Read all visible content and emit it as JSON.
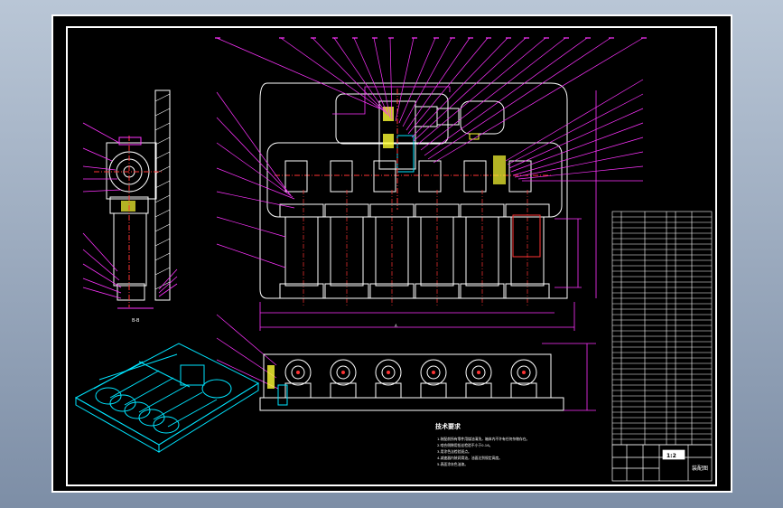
{
  "drawing": {
    "colors": {
      "background": "#000000",
      "frame": "#ffffff",
      "geometry": "#ffffff",
      "leader": "#ff33ff",
      "dimension": "#ff33ff",
      "centerline": "#ff3333",
      "hidden": "#ffff33",
      "isometric": "#00e5ff",
      "desktop": "#9aa9bd"
    },
    "views": {
      "section_label": "B-B",
      "top_label": "A"
    },
    "tech_requirements": {
      "title": "技术要求",
      "items": [
        "1.装配前所有零件用煤油清洗，箱体内不许有任何杂物存在。",
        "2.啮合侧隙用铅丝检验不小于0.16。",
        "3.用涂色法检验斑点。",
        "4.减速器内装润滑油，油面达到规定高度。",
        "5.表面涂灰色油漆。"
      ]
    },
    "title_block": {
      "scale": "1:2",
      "sheet_no": "装配图"
    }
  },
  "icons": {
    "isometric": "isometric-assembly-icon"
  }
}
